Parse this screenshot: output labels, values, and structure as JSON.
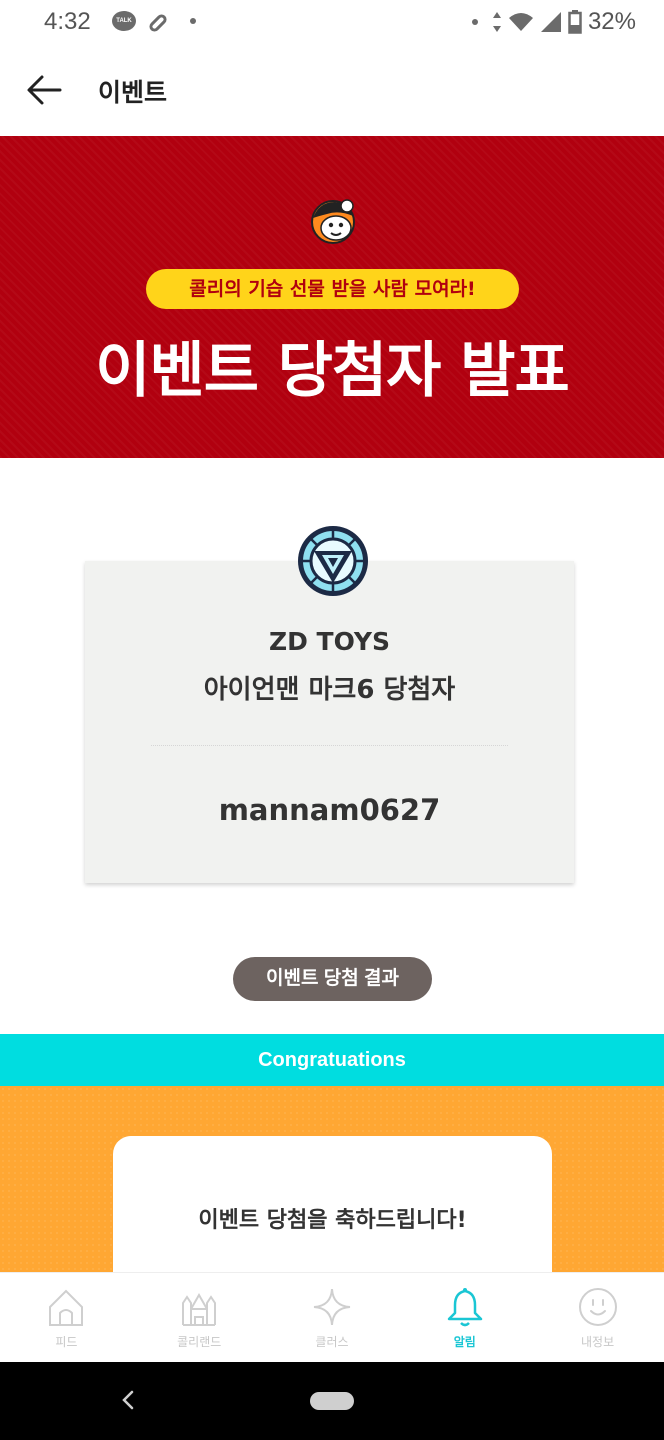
{
  "status_bar": {
    "time": "4:32",
    "battery": "32%",
    "talk_badge": "TALK",
    "icons": [
      "kakaotalk-icon",
      "pill-icon",
      "dot-icon",
      "wifi-icon",
      "signal-icon",
      "battery-icon"
    ]
  },
  "app_bar": {
    "title": "이벤트",
    "back_icon": "arrow-left-icon"
  },
  "banner": {
    "pill_text": "콜리의 기습 선물 받을 사람 모여라!",
    "title": "이벤트 당첨자 발표",
    "background_color": "#b1000f",
    "pill_color": "#ffd41a"
  },
  "winner_card": {
    "brand": "ZD TOYS",
    "prize": "아이언맨 마크6 당첨자",
    "winner_id": "mannam0627",
    "logo_icon": "arc-reactor-icon"
  },
  "result_button": {
    "label": "이벤트 당첨 결과"
  },
  "congrats": {
    "strip_text": "Congratuations",
    "message": "이벤트 당첨을 축하드립니다!",
    "strip_color": "#00dde0",
    "section_color": "#ffa733"
  },
  "bottom_nav": {
    "items": [
      {
        "label": "피드",
        "icon": "home-icon",
        "active": false
      },
      {
        "label": "콜리랜드",
        "icon": "castle-icon",
        "active": false
      },
      {
        "label": "클러스",
        "icon": "sparkle-icon",
        "active": false
      },
      {
        "label": "알림",
        "icon": "bell-icon",
        "active": true
      },
      {
        "label": "내정보",
        "icon": "smiley-icon",
        "active": false
      }
    ],
    "active_color": "#1ac6d4"
  }
}
